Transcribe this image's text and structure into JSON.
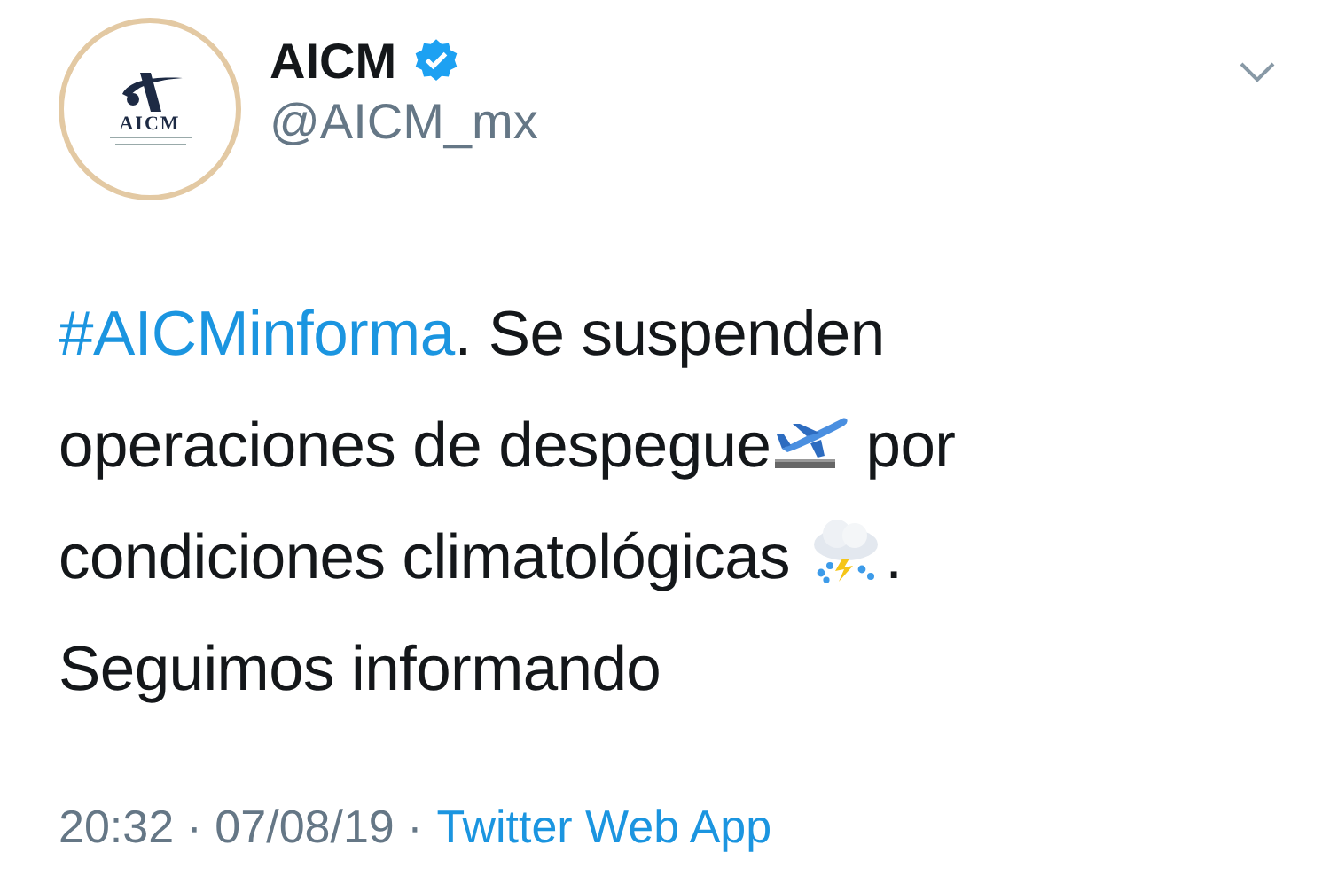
{
  "author": {
    "avatar_text": "AICM",
    "name": "AICM",
    "verified": true,
    "handle": "@AICM_mx"
  },
  "tweet": {
    "text": [
      {
        "kind": "hashtag",
        "text": "#AICMinforma"
      },
      {
        "kind": "text",
        "text": ". Se suspenden operaciones de despegue"
      },
      {
        "kind": "emoji"
      },
      {
        "kind": "text",
        "text": " por condiciones climatológicas "
      },
      {
        "kind": "emoji"
      },
      {
        "kind": "text",
        "text": ". Seguimos informando"
      }
    ]
  },
  "footer": {
    "timestamp": "20:32 · 07/08/19 ·",
    "source": "Twitter Web App"
  }
}
